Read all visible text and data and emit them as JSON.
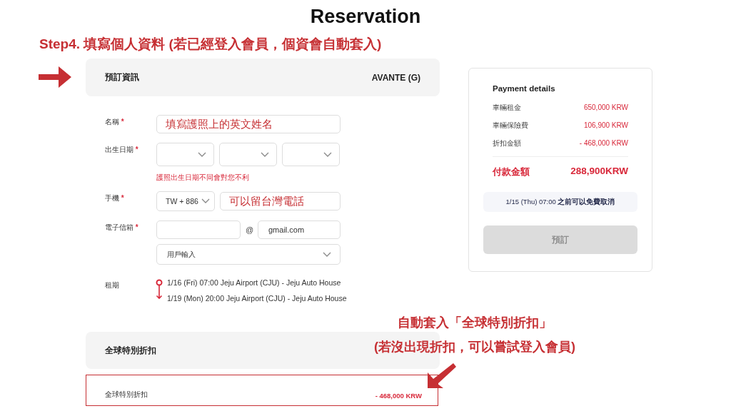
{
  "title": "Reservation",
  "step_note": "Step4. 填寫個人資料 (若已經登入會員，個資會自動套入)",
  "booking_header": {
    "title": "預訂資訊",
    "car": "AVANTE (G)"
  },
  "form": {
    "name": {
      "label": "名稱",
      "mark": "*",
      "value": "填寫護照上的英文姓名"
    },
    "birth": {
      "label": "出生日期",
      "mark": "*",
      "hint": "護照出生日期不同會對您不利"
    },
    "phone": {
      "label": "手機",
      "mark": "*",
      "country": "TW + 886",
      "value": "可以留台灣電話"
    },
    "email": {
      "label": "電子信箱",
      "mark": "*",
      "at": "@",
      "domain": "gmail.com",
      "domain_select": "用戶輸入"
    },
    "rental": {
      "label": "租期",
      "pickup": "1/16 (Fri) 07:00 Jeju Airport (CJU) - Jeju Auto House",
      "return": "1/19 (Mon) 20:00 Jeju Airport (CJU) - Jeju Auto House"
    }
  },
  "discount": {
    "title": "全球特別折扣",
    "label": "全球特別折扣",
    "amount": "- 468,000 KRW",
    "highlighted": true
  },
  "payment": {
    "title": "Payment details",
    "rows": [
      {
        "label": "車輛租金",
        "amount": "650,000 KRW"
      },
      {
        "label": "車輛保險費",
        "amount": "106,900 KRW"
      },
      {
        "label": "折扣金額",
        "amount": "- 468,000 KRW"
      }
    ],
    "total_label": "付款金額",
    "total_amount": "288,900KRW",
    "cancel_note": "1/15 (Thu) 07:00 **之前可以免費取消**",
    "book_button": {
      "label": "預訂",
      "disabled": true
    }
  },
  "discount_note": [
    "自動套入「全球特別折扣」",
    "(若沒出現折扣，可以嘗試登入會員)"
  ]
}
